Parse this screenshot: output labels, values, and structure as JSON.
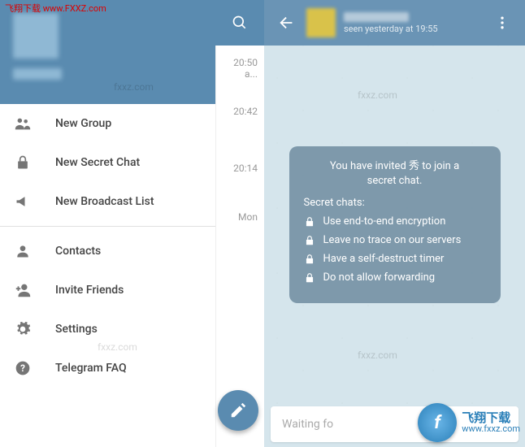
{
  "watermark": {
    "top_text": "飞翔下载 www.FXXZ.com",
    "brand_cn": "飞翔下载",
    "brand_url": "www.fxxz.com",
    "repeat": "fxxz.com"
  },
  "drawer": {
    "items_a": [
      {
        "icon": "group",
        "label": "New Group"
      },
      {
        "icon": "lock",
        "label": "New Secret Chat"
      },
      {
        "icon": "megaphone",
        "label": "New Broadcast List"
      }
    ],
    "items_b": [
      {
        "icon": "person",
        "label": "Contacts"
      },
      {
        "icon": "person-add",
        "label": "Invite Friends"
      },
      {
        "icon": "gear",
        "label": "Settings"
      },
      {
        "icon": "help",
        "label": "Telegram FAQ"
      }
    ]
  },
  "chatlist": {
    "t1": "20:50",
    "p1": "a...",
    "t2": "20:42",
    "t3": "20:14",
    "t4": "Mon"
  },
  "chat": {
    "status": "seen yesterday at 19:55",
    "info_title_1": "You have invited 秀 to join a",
    "info_title_2": "secret chat.",
    "info_subtitle": "Secret chats:",
    "bullets": [
      "Use end-to-end encryption",
      "Leave no trace on our servers",
      "Have a self-destruct timer",
      "Do not allow forwarding"
    ],
    "input": "Waiting fo"
  }
}
